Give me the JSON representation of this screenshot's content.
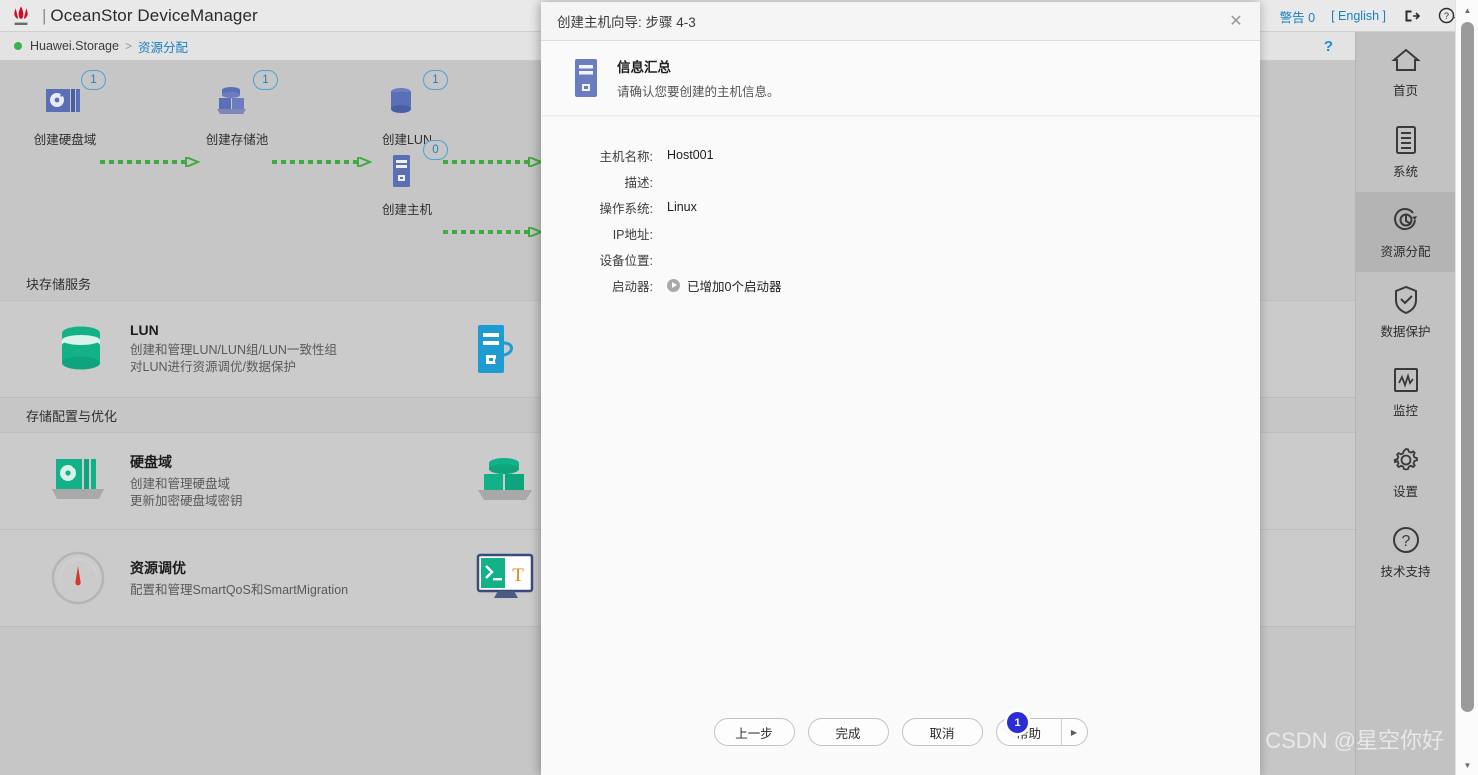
{
  "header": {
    "logo_name": "huawei-logo",
    "separator": "|",
    "app_title": "OceanStor DeviceManager",
    "warning_label": "警告 0",
    "language_label": "[ English ]",
    "logout_icon": "logout-icon",
    "help_icon": "help-dropdown-icon"
  },
  "breadcrumb": {
    "root": "Huawei.Storage",
    "arrow": ">",
    "leaf": "资源分配",
    "help_mark": "?"
  },
  "workflow": {
    "nodes": [
      {
        "label": "创建硬盘域",
        "badge": "1",
        "icon": "disk-domain-icon"
      },
      {
        "label": "创建存储池",
        "badge": "1",
        "icon": "storage-pool-icon"
      },
      {
        "label": "创建LUN",
        "badge": "1",
        "icon": "lun-icon"
      },
      {
        "label": "创建主机",
        "badge": "0",
        "icon": "host-icon"
      }
    ]
  },
  "sections": [
    {
      "title": "块存储服务",
      "cards": [
        {
          "title": "LUN",
          "desc1": "创建和管理LUN/LUN组/LUN一致性组",
          "desc2": "对LUN进行资源调优/数据保护",
          "icon": "lun-cylinder-icon"
        },
        {
          "title": "",
          "desc1": "",
          "desc2": "",
          "icon": "host-server-icon"
        }
      ]
    },
    {
      "title": "存储配置与优化",
      "cards": [
        {
          "title": "硬盘域",
          "desc1": "创建和管理硬盘域",
          "desc2": "更新加密硬盘域密钥",
          "icon": "disk-domain-card-icon"
        },
        {
          "title": "",
          "desc1": "",
          "desc2": "",
          "icon": "storage-pool-card-icon"
        }
      ]
    },
    {
      "title": "",
      "cards": [
        {
          "title": "资源调优",
          "desc1": "配置和管理SmartQoS和SmartMigration",
          "desc2": "",
          "icon": "gauge-icon"
        },
        {
          "title": "",
          "desc1": "",
          "desc2": "",
          "icon": "cli-terminal-icon"
        }
      ]
    }
  ],
  "rail": {
    "items": [
      {
        "label": "首页",
        "icon": "home-icon",
        "active": false
      },
      {
        "label": "系统",
        "icon": "system-icon",
        "active": false
      },
      {
        "label": "资源分配",
        "icon": "resource-allocation-icon",
        "active": true
      },
      {
        "label": "数据保护",
        "icon": "shield-check-icon",
        "active": false
      },
      {
        "label": "监控",
        "icon": "monitor-chart-icon",
        "active": false
      },
      {
        "label": "设置",
        "icon": "gear-icon",
        "active": false
      },
      {
        "label": "技术支持",
        "icon": "question-circle-icon",
        "active": false
      }
    ]
  },
  "dialog": {
    "title": "创建主机向导: 步骤 4-3",
    "close_icon": "close-icon",
    "head_icon": "host-tower-icon",
    "head_title": "信息汇总",
    "head_sub": "请确认您要创建的主机信息。",
    "fields": [
      {
        "label": "主机名称:",
        "value": "Host001"
      },
      {
        "label": "描述:",
        "value": ""
      },
      {
        "label": "操作系统:",
        "value": "Linux"
      },
      {
        "label": "IP地址:",
        "value": ""
      },
      {
        "label": "设备位置:",
        "value": ""
      },
      {
        "label": "启动器:",
        "value": "已增加0个启动器",
        "icon": "play-circle-icon"
      }
    ],
    "buttons": {
      "prev": "上一步",
      "finish": "完成",
      "cancel": "取消",
      "help": "帮助",
      "help_arrow": "▶"
    },
    "click_marker": "1"
  },
  "watermark": "CSDN @星空你好",
  "scrollbar": {
    "up": "▲",
    "down": "▼"
  },
  "colors": {
    "accent_blue": "#1a7fc1",
    "green": "#35b54a",
    "teal": "#12b188",
    "node_blue": "#5a6fb5",
    "marker_blue": "#2b2bd8"
  }
}
